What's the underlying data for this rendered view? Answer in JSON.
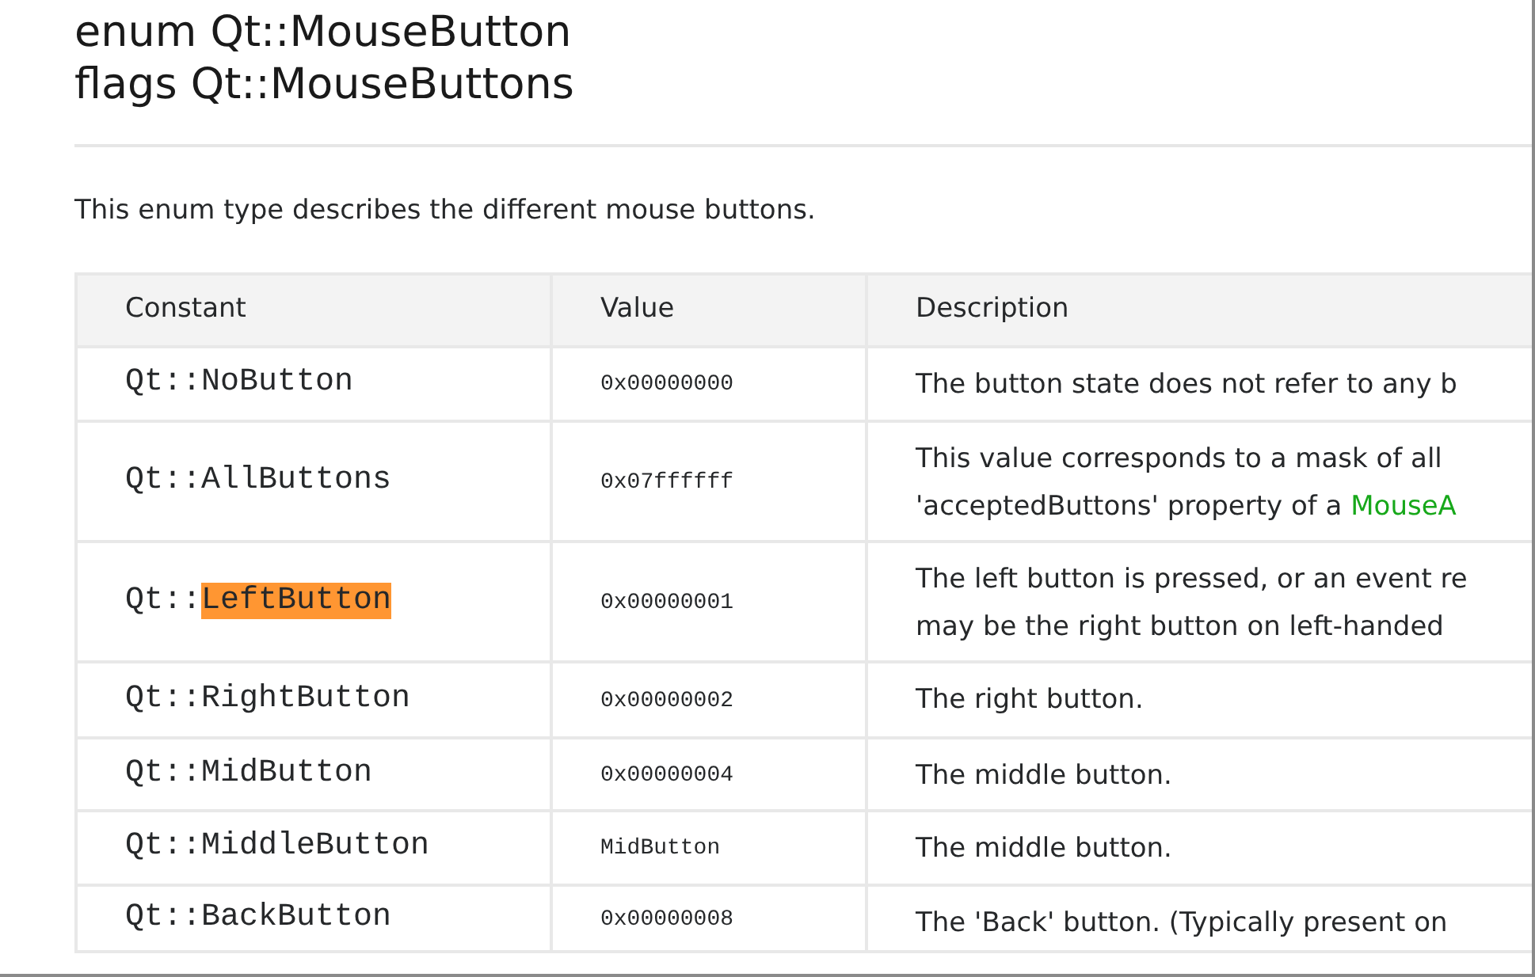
{
  "title_lines": [
    "enum Qt::MouseButton",
    "flags Qt::MouseButtons"
  ],
  "intro": "This enum type describes the different mouse buttons.",
  "table": {
    "columns": [
      "Constant",
      "Value",
      "Description"
    ],
    "rows": [
      {
        "constant": [
          {
            "text": "Qt::NoButton",
            "highlighted": false
          }
        ],
        "value": "0x00000000",
        "description": [
          [
            {
              "text": "The button state does not refer to any b",
              "kind": "plain"
            }
          ]
        ]
      },
      {
        "constant": [
          {
            "text": "Qt::AllButtons",
            "highlighted": false
          }
        ],
        "value": "0x07ffffff",
        "description": [
          [
            {
              "text": "This value corresponds to a mask of all",
              "kind": "plain"
            }
          ],
          [
            {
              "text": "'acceptedButtons' property of a ",
              "kind": "plain"
            },
            {
              "text": "MouseA",
              "kind": "link"
            }
          ]
        ]
      },
      {
        "constant": [
          {
            "text": "Qt::",
            "highlighted": false
          },
          {
            "text": "LeftButton",
            "highlighted": true
          }
        ],
        "value": "0x00000001",
        "description": [
          [
            {
              "text": "The left button is pressed, or an event re",
              "kind": "plain"
            }
          ],
          [
            {
              "text": "may be the right button on left-handed",
              "kind": "plain"
            }
          ]
        ]
      },
      {
        "constant": [
          {
            "text": "Qt::RightButton",
            "highlighted": false
          }
        ],
        "value": "0x00000002",
        "description": [
          [
            {
              "text": "The right button.",
              "kind": "plain"
            }
          ]
        ]
      },
      {
        "constant": [
          {
            "text": "Qt::MidButton",
            "highlighted": false
          }
        ],
        "value": "0x00000004",
        "description": [
          [
            {
              "text": "The middle button.",
              "kind": "plain"
            }
          ]
        ]
      },
      {
        "constant": [
          {
            "text": "Qt::MiddleButton",
            "highlighted": false
          }
        ],
        "value": "MidButton",
        "description": [
          [
            {
              "text": "The middle button.",
              "kind": "plain"
            }
          ]
        ]
      },
      {
        "constant": [
          {
            "text": "Qt::BackButton",
            "highlighted": false
          }
        ],
        "value": "0x00000008",
        "description": [
          [
            {
              "text": "The 'Back' button. (Typically present on",
              "kind": "plain"
            }
          ]
        ]
      }
    ]
  }
}
